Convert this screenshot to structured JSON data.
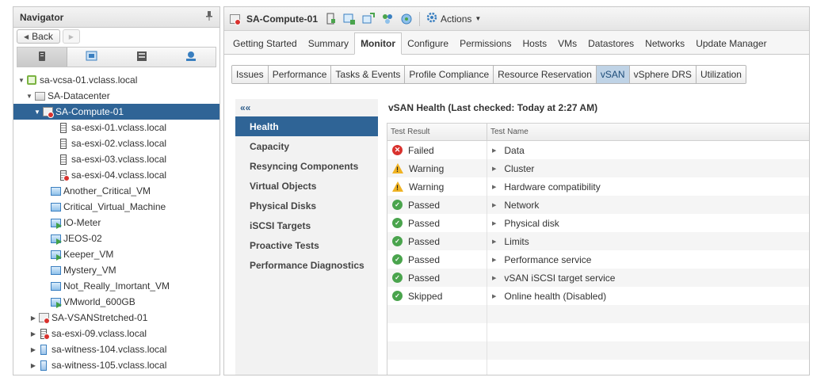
{
  "navigator": {
    "title": "Navigator",
    "back_label": "Back",
    "icon_tabs": [
      "hosts-clusters-icon",
      "vms-templates-icon",
      "storage-icon",
      "networking-icon"
    ],
    "tree": [
      {
        "label": "sa-vcsa-01.vclass.local",
        "depth": 0,
        "twisty": "open",
        "icon": "vcenter-icon"
      },
      {
        "label": "SA-Datacenter",
        "depth": 1,
        "twisty": "open",
        "icon": "datacenter-icon"
      },
      {
        "label": "SA-Compute-01",
        "depth": 2,
        "twisty": "open",
        "icon": "cluster-alert-icon",
        "selected": true
      },
      {
        "label": "sa-esxi-01.vclass.local",
        "depth": 4,
        "twisty": "",
        "icon": "host-icon"
      },
      {
        "label": "sa-esxi-02.vclass.local",
        "depth": 4,
        "twisty": "",
        "icon": "host-icon"
      },
      {
        "label": "sa-esxi-03.vclass.local",
        "depth": 4,
        "twisty": "",
        "icon": "host-icon"
      },
      {
        "label": "sa-esxi-04.vclass.local",
        "depth": 4,
        "twisty": "",
        "icon": "host-alert-icon"
      },
      {
        "label": "Another_Critical_VM",
        "depth": 3,
        "twisty": "",
        "icon": "vm-icon"
      },
      {
        "label": "Critical_Virtual_Machine",
        "depth": 3,
        "twisty": "",
        "icon": "vm-icon"
      },
      {
        "label": "IO-Meter",
        "depth": 3,
        "twisty": "",
        "icon": "vm-running-icon"
      },
      {
        "label": "JEOS-02",
        "depth": 3,
        "twisty": "",
        "icon": "vm-running-icon"
      },
      {
        "label": "Keeper_VM",
        "depth": 3,
        "twisty": "",
        "icon": "vm-running-icon"
      },
      {
        "label": "Mystery_VM",
        "depth": 3,
        "twisty": "",
        "icon": "vm-icon"
      },
      {
        "label": "Not_Really_Imortant_VM",
        "depth": 3,
        "twisty": "",
        "icon": "vm-icon"
      },
      {
        "label": "VMworld_600GB",
        "depth": 3,
        "twisty": "",
        "icon": "vm-running-icon"
      },
      {
        "label": "SA-VSANStretched-01",
        "depth": 1.5,
        "twisty": "closed",
        "icon": "cluster-alert-icon"
      },
      {
        "label": "sa-esxi-09.vclass.local",
        "depth": 1.5,
        "twisty": "closed",
        "icon": "host-alert-icon"
      },
      {
        "label": "sa-witness-104.vclass.local",
        "depth": 1.5,
        "twisty": "closed",
        "icon": "witness-host-icon"
      },
      {
        "label": "sa-witness-105.vclass.local",
        "depth": 1.5,
        "twisty": "closed",
        "icon": "witness-host-icon"
      }
    ]
  },
  "toolbar": {
    "object_title": "SA-Compute-01",
    "actions_label": "Actions",
    "icons": [
      "add-host-icon",
      "new-vm-icon",
      "deploy-ovf-icon",
      "new-resource-pool-icon",
      "new-vapp-icon"
    ]
  },
  "main_tabs": [
    {
      "label": "Getting Started"
    },
    {
      "label": "Summary"
    },
    {
      "label": "Monitor",
      "active": true
    },
    {
      "label": "Configure"
    },
    {
      "label": "Permissions"
    },
    {
      "label": "Hosts"
    },
    {
      "label": "VMs"
    },
    {
      "label": "Datastores"
    },
    {
      "label": "Networks"
    },
    {
      "label": "Update Manager"
    }
  ],
  "sub_tabs": [
    {
      "label": "Issues"
    },
    {
      "label": "Performance"
    },
    {
      "label": "Tasks & Events"
    },
    {
      "label": "Profile Compliance"
    },
    {
      "label": "Resource Reservation"
    },
    {
      "label": "vSAN",
      "active": true
    },
    {
      "label": "vSphere DRS"
    },
    {
      "label": "Utilization"
    }
  ],
  "vsan_menu": {
    "collapse_glyph": "««",
    "items": [
      {
        "label": "Health",
        "active": true
      },
      {
        "label": "Capacity"
      },
      {
        "label": "Resyncing Components"
      },
      {
        "label": "Virtual Objects"
      },
      {
        "label": "Physical Disks"
      },
      {
        "label": "iSCSI Targets"
      },
      {
        "label": "Proactive Tests"
      },
      {
        "label": "Performance Diagnostics"
      }
    ]
  },
  "health": {
    "title": "vSAN Health (Last checked: Today at 2:27 AM)",
    "col_result": "Test Result",
    "col_name": "Test Name",
    "rows": [
      {
        "status": "failed",
        "result": "Failed",
        "name": "Data"
      },
      {
        "status": "warning",
        "result": "Warning",
        "name": "Cluster"
      },
      {
        "status": "warning",
        "result": "Warning",
        "name": "Hardware compatibility"
      },
      {
        "status": "passed",
        "result": "Passed",
        "name": "Network"
      },
      {
        "status": "passed",
        "result": "Passed",
        "name": "Physical disk"
      },
      {
        "status": "passed",
        "result": "Passed",
        "name": "Limits"
      },
      {
        "status": "passed",
        "result": "Passed",
        "name": "Performance service"
      },
      {
        "status": "passed",
        "result": "Passed",
        "name": "vSAN iSCSI target service"
      },
      {
        "status": "passed",
        "result": "Skipped",
        "name": "Online health (Disabled)"
      }
    ],
    "empty_rows": 4
  },
  "colors": {
    "selection_blue": "#2f6496",
    "active_subtab": "#bfd3e6",
    "failed_red": "#d9322e",
    "warning_yellow": "#f0b323",
    "passed_green": "#4aa44d"
  }
}
